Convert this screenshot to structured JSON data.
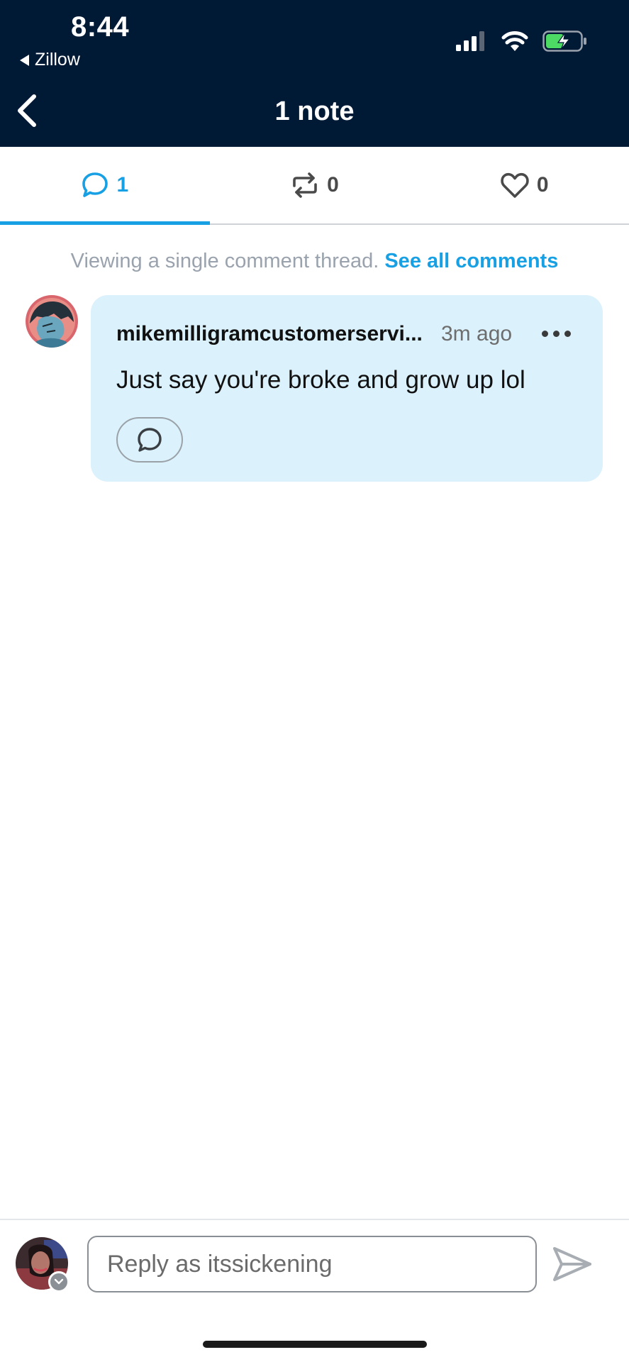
{
  "status_bar": {
    "time": "8:44",
    "back_app": "Zillow",
    "signal_icon": "signal-bars-icon",
    "wifi_icon": "wifi-icon",
    "battery_icon": "battery-charging-icon"
  },
  "nav": {
    "title": "1 note",
    "back_icon": "chevron-left-icon"
  },
  "tabs": [
    {
      "icon": "comment-icon",
      "count": "1",
      "active": true
    },
    {
      "icon": "reblog-icon",
      "count": "0",
      "active": false
    },
    {
      "icon": "heart-icon",
      "count": "0",
      "active": false
    }
  ],
  "thread": {
    "notice": "Viewing a single comment thread.",
    "see_all": "See all comments"
  },
  "comment": {
    "username": "mikemilligramcustomerservi...",
    "time": "3m ago",
    "text": "Just say you're broke and grow up lol"
  },
  "reply": {
    "placeholder": "Reply as itssickening"
  },
  "colors": {
    "header_bg": "#001935",
    "accent": "#18a0e4",
    "bubble_bg": "#dbf1fc"
  }
}
